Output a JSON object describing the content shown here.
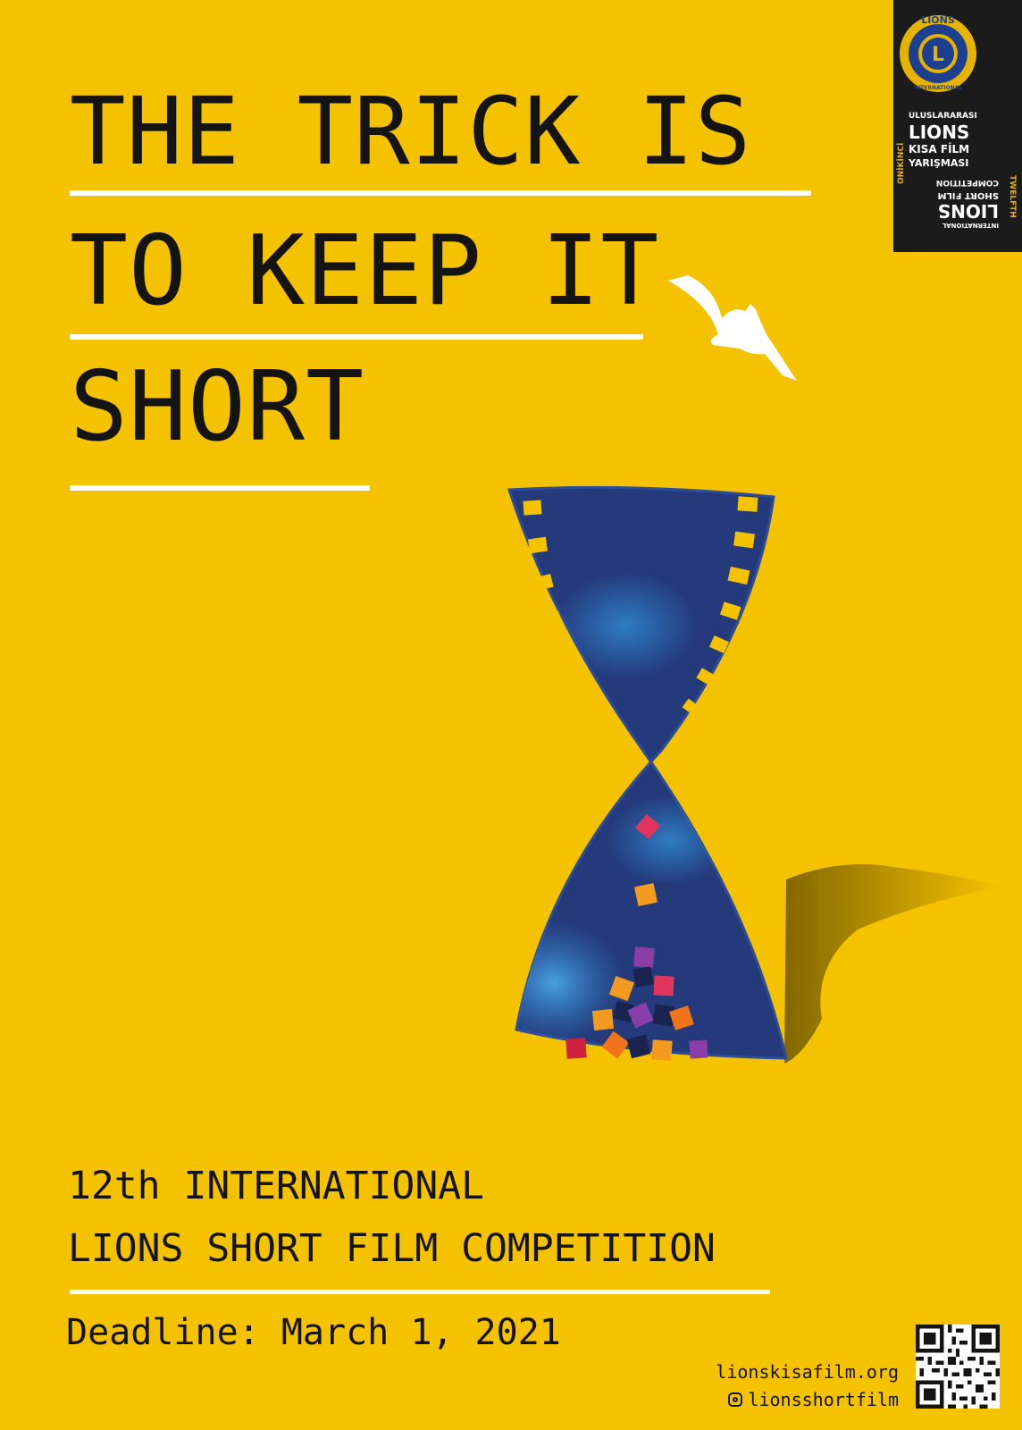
{
  "headline": {
    "line1": "THE TRICK IS",
    "line2": "TO KEEP IT",
    "line3": "SHORT"
  },
  "event": {
    "line1": "12th INTERNATIONAL",
    "line2": "LIONS SHORT FILM COMPETITION",
    "deadline": "Deadline: March 1, 2021"
  },
  "badge": {
    "emblem_ring_text": "LIONS",
    "emblem_ring_bottom": "INTERNATIONAL",
    "emblem_letter": "L",
    "side_tr": "ONİKİNCİ",
    "tr_line1": "ULUSLARARASI",
    "tr_line2": "LIONS",
    "tr_line3": "KISA FİLM",
    "tr_line4": "YARIŞMASI",
    "side_en": "TWELFTH",
    "en_line1": "INTERNATIONAL",
    "en_line2": "LIONS",
    "en_line3": "SHORT FILM",
    "en_line4": "COMPETITION"
  },
  "contact": {
    "website": "lionskisafilm.org",
    "instagram": "lionsshortfilm"
  },
  "colors": {
    "background": "#f5c200",
    "text": "#141414",
    "film": "#243a7a",
    "film_light": "#2f7fc7",
    "badge_bg": "#1b1b1b",
    "emblem_gold": "#e6b400",
    "emblem_blue": "#1d3f8f"
  }
}
